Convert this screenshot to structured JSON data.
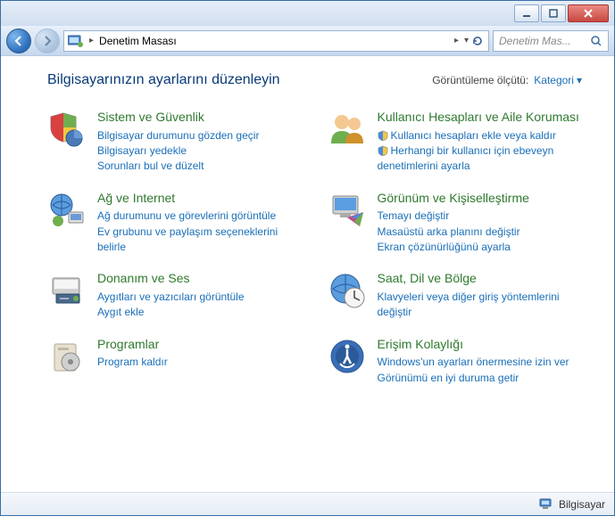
{
  "titlebar": {},
  "nav": {
    "breadcrumb_root": "Denetim Masası",
    "search_placeholder": "Denetim Mas..."
  },
  "header": {
    "title": "Bilgisayarınızın ayarlarını düzenleyin",
    "view_label": "Görüntüleme ölçütü:",
    "view_value": "Kategori"
  },
  "left": [
    {
      "title": "Sistem ve Güvenlik",
      "links": [
        "Bilgisayar durumunu gözden geçir",
        "Bilgisayarı yedekle",
        "Sorunları bul ve düzelt"
      ]
    },
    {
      "title": "Ağ ve Internet",
      "links": [
        "Ağ durumunu ve görevlerini görüntüle",
        "Ev grubunu ve paylaşım seçeneklerini belirle"
      ]
    },
    {
      "title": "Donanım ve Ses",
      "links": [
        "Aygıtları ve yazıcıları görüntüle",
        "Aygıt ekle"
      ]
    },
    {
      "title": "Programlar",
      "links": [
        "Program kaldır"
      ]
    }
  ],
  "right": [
    {
      "title": "Kullanıcı Hesapları ve Aile Koruması",
      "links": [
        {
          "shield": true,
          "text": "Kullanıcı hesapları ekle veya kaldır"
        },
        {
          "shield": true,
          "text": "Herhangi bir kullanıcı için ebeveyn denetimlerini ayarla"
        }
      ]
    },
    {
      "title": "Görünüm ve Kişiselleştirme",
      "links": [
        "Temayı değiştir",
        "Masaüstü arka planını değiştir",
        "Ekran çözünürlüğünü ayarla"
      ]
    },
    {
      "title": "Saat, Dil ve Bölge",
      "links": [
        "Klavyeleri veya diğer giriş yöntemlerini değiştir"
      ]
    },
    {
      "title": "Erişim Kolaylığı",
      "links": [
        "Windows'un ayarları önermesine izin ver",
        "Görünümü en iyi duruma getir"
      ]
    }
  ],
  "status": {
    "text": "Bilgisayar"
  }
}
